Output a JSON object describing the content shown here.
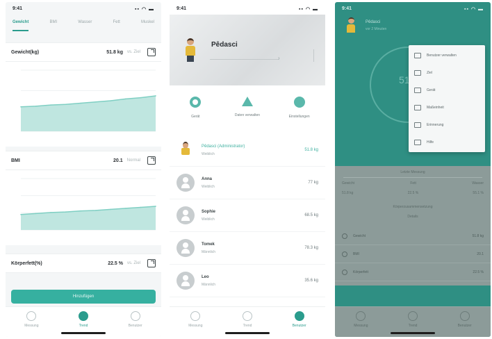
{
  "status": {
    "time": "9:41",
    "signal": "▪▪ ◠ ▬"
  },
  "phone1": {
    "tabs": [
      "Gewicht",
      "BMI",
      "Wasser",
      "Fett",
      "Muskel"
    ],
    "active_tab": 0,
    "cards": [
      {
        "title": "Gewicht(kg)",
        "value": "51.8 kg",
        "unit": "vs. Ziel"
      },
      {
        "title": "BMI",
        "value": "20.1",
        "unit": "Normal"
      },
      {
        "title": "Körperfett(%)",
        "value": "22.5 %",
        "unit": "vs. Ziel"
      }
    ],
    "button_label": "Hinzufügen",
    "nav": [
      "Messung",
      "Trend",
      "Benutzer"
    ],
    "nav_active": 1
  },
  "phone2": {
    "profile_name": "Pêdasci",
    "profile_arrow": "›",
    "actions": [
      "Gerät",
      "Daten verwalten",
      "Einstellungen"
    ],
    "members": [
      {
        "name": "Pêdasci (Administrator)",
        "sub": "Weiblich",
        "weight": "51.8 kg",
        "selected": true
      },
      {
        "name": "Anna",
        "sub": "Weiblich",
        "weight": "77 kg",
        "selected": false
      },
      {
        "name": "Sophie",
        "sub": "Weiblich",
        "weight": "68.5 kg",
        "selected": false
      },
      {
        "name": "Tomek",
        "sub": "Männlich",
        "weight": "78.3 kg",
        "selected": false
      },
      {
        "name": "Leo",
        "sub": "Männlich",
        "weight": "35.6 kg",
        "selected": false
      }
    ],
    "nav": [
      "Messung",
      "Trend",
      "Benutzer"
    ],
    "nav_active": 2
  },
  "phone3": {
    "user_name": "Pêdasci",
    "user_sub": "vor 2 Minuten",
    "gauge_value": "51.8",
    "dropdown": [
      "Benutzer verwalten",
      "Ziel",
      "Gerät",
      "Maßeinheit",
      "Erinnerung",
      "Hilfe"
    ],
    "panel_title": "Letzte Messung",
    "panel_cols": [
      "Gewicht",
      "Fett",
      "Wasser"
    ],
    "panel_vals": [
      "51.8 kg",
      "22.5 %",
      "55.1 %"
    ],
    "panel_note": "Körperzusammensetzung",
    "panel_link": "Details",
    "list": [
      {
        "label": "Gewicht",
        "value": "51.8 kg"
      },
      {
        "label": "BMI",
        "value": "20.1"
      },
      {
        "label": "Körperfett",
        "value": "22.5 %"
      }
    ],
    "nav": [
      "Messung",
      "Trend",
      "Benutzer"
    ]
  },
  "chart_data": [
    {
      "type": "area",
      "x": [
        1,
        2,
        3,
        4,
        5,
        6,
        7,
        8,
        9,
        10
      ],
      "values": [
        40,
        41,
        43,
        44,
        46,
        48,
        50,
        53,
        55,
        58
      ],
      "ylim": [
        0,
        100
      ]
    },
    {
      "type": "area",
      "x": [
        1,
        2,
        3,
        4,
        5,
        6,
        7,
        8,
        9,
        10
      ],
      "values": [
        30,
        32,
        34,
        35,
        37,
        38,
        40,
        42,
        44,
        46
      ],
      "ylim": [
        0,
        100
      ]
    }
  ]
}
